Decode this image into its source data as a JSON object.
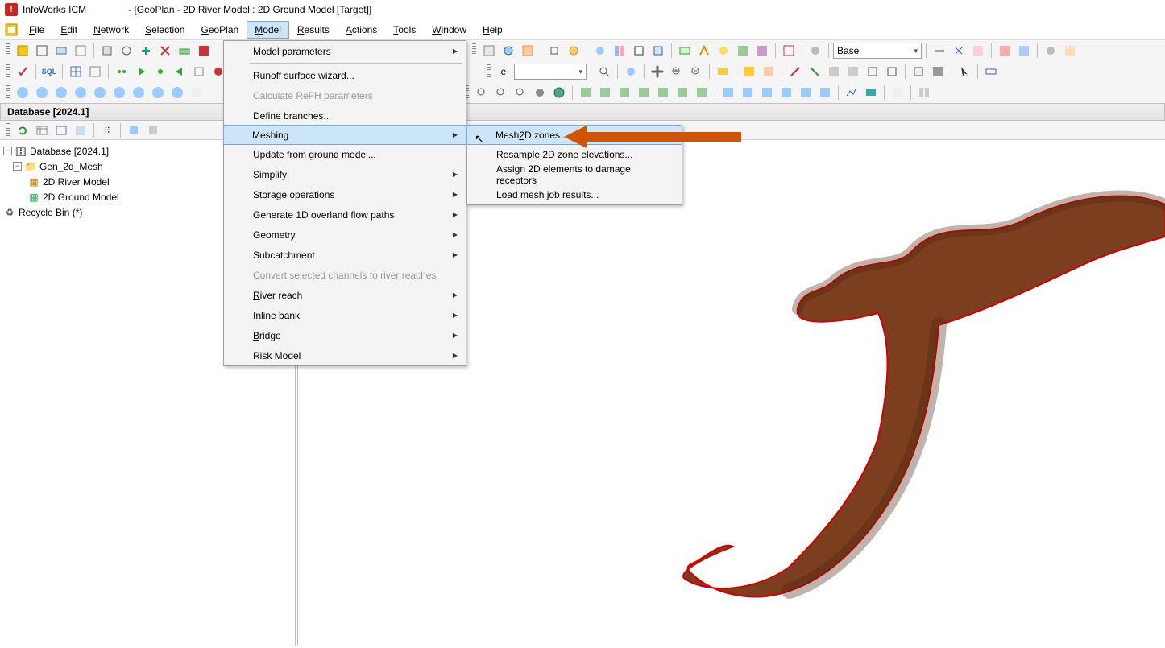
{
  "titlebar": {
    "app": "InfoWorks ICM",
    "doc": "- [GeoPlan - 2D River Model : 2D Ground Model  [Target]]"
  },
  "menubar": {
    "file": "File",
    "edit": "Edit",
    "network": "Network",
    "selection": "Selection",
    "geoplan": "GeoPlan",
    "model": "Model",
    "results": "Results",
    "actions": "Actions",
    "tools": "Tools",
    "window": "Window",
    "help": "Help"
  },
  "toolbar": {
    "combo_base": "Base"
  },
  "db_panel": {
    "header": "Database [2024.1]",
    "root": "Database [2024.1]",
    "group": "Gen_2d_Mesh",
    "river": "2D River Model",
    "ground": "2D Ground Model",
    "recycle": "Recycle Bin (*)"
  },
  "menu_model": {
    "params": "Model parameters",
    "runoff": "Runoff surface wizard...",
    "refh": "Calculate ReFH parameters",
    "branches": "Define branches...",
    "meshing": "Meshing",
    "update_gm": "Update from ground model...",
    "simplify": "Simplify",
    "storage": "Storage operations",
    "overland": "Generate 1D overland flow paths",
    "geometry": "Geometry",
    "subcatch": "Subcatchment",
    "convert": "Convert selected channels to river reaches",
    "riverreach": "River reach",
    "inline": "Inline bank",
    "bridge": "Bridge",
    "risk": "Risk Model"
  },
  "menu_meshing": {
    "mesh2d": "Mesh 2D zones...",
    "resample": "Resample 2D zone elevations...",
    "assign": "Assign 2D elements to damage receptors",
    "loadjob": "Load mesh job results..."
  }
}
